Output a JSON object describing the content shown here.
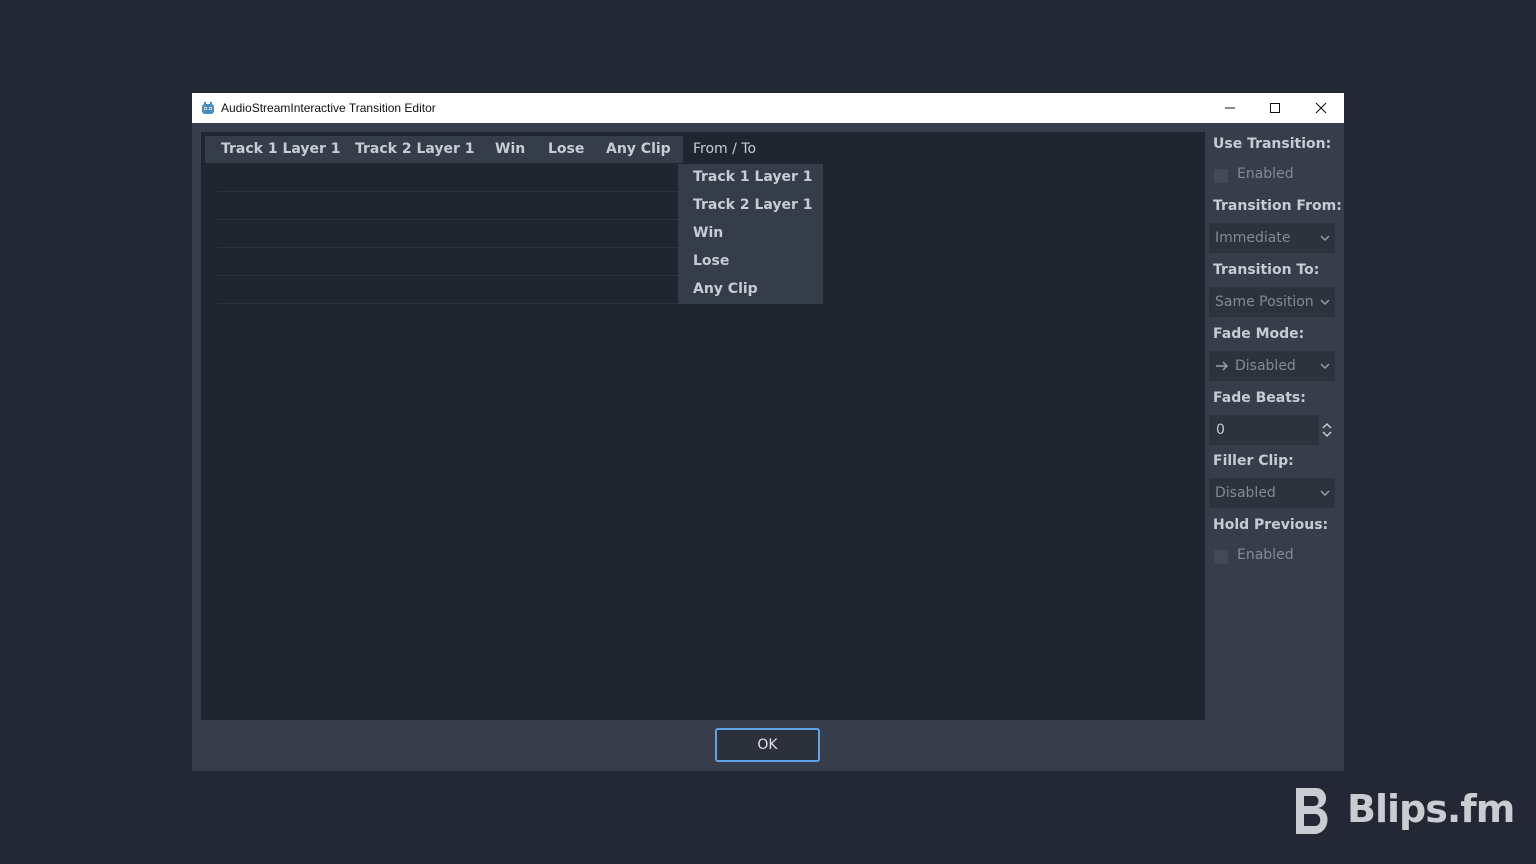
{
  "window": {
    "title": "AudioStreamInteractive Transition Editor"
  },
  "table": {
    "columns": [
      "Track 1 Layer 1",
      "Track 2 Layer 1",
      "Win",
      "Lose",
      "Any Clip"
    ],
    "corner_label": "From / To",
    "rows": [
      "Track 1 Layer 1",
      "Track 2 Layer 1",
      "Win",
      "Lose",
      "Any Clip"
    ]
  },
  "side": {
    "use_transition_label": "Use Transition:",
    "use_transition_checkbox": "Enabled",
    "transition_from_label": "Transition From:",
    "transition_from_value": "Immediate",
    "transition_to_label": "Transition To:",
    "transition_to_value": "Same Position",
    "fade_mode_label": "Fade Mode:",
    "fade_mode_value": "Disabled",
    "fade_beats_label": "Fade Beats:",
    "fade_beats_value": "0",
    "filler_clip_label": "Filler Clip:",
    "filler_clip_value": "Disabled",
    "hold_previous_label": "Hold Previous:",
    "hold_previous_checkbox": "Enabled"
  },
  "footer": {
    "ok_label": "OK"
  },
  "watermark": {
    "text": "Blips.fm"
  },
  "colors": {
    "background": "#232834",
    "dialog": "#373d4b",
    "panel": "#212530",
    "accent": "#5fa3e9"
  }
}
